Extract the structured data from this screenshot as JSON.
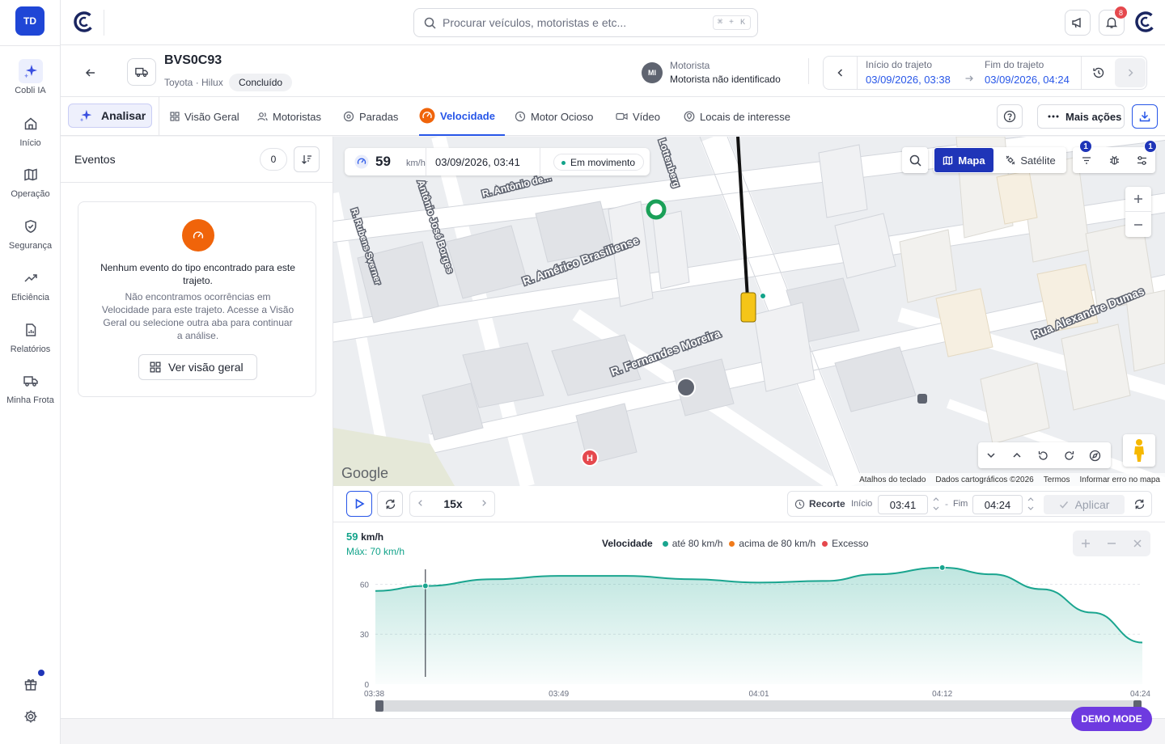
{
  "user": {
    "initials": "TD"
  },
  "nav": {
    "items": [
      {
        "label": "Cobli IA",
        "icon": "sparkle-icon"
      },
      {
        "label": "Início",
        "icon": "home-icon"
      },
      {
        "label": "Operação",
        "icon": "map-icon"
      },
      {
        "label": "Segurança",
        "icon": "shield-icon"
      },
      {
        "label": "Eficiência",
        "icon": "trend-icon"
      },
      {
        "label": "Relatórios",
        "icon": "report-icon"
      },
      {
        "label": "Minha Frota",
        "icon": "truck-icon"
      }
    ]
  },
  "topbar": {
    "search_placeholder": "Procurar veículos, motoristas e etc...",
    "shortcut": "⌘ + K",
    "notifications_count": "8"
  },
  "vehicle": {
    "plate": "BVS0C93",
    "model": "Toyota · Hilux",
    "status": "Concluído"
  },
  "driver": {
    "initials": "MI",
    "label": "Motorista",
    "name": "Motorista não identificado"
  },
  "trip": {
    "start_label": "Início do trajeto",
    "start_value": "03/09/2026, 03:38",
    "end_label": "Fim do trajeto",
    "end_value": "03/09/2026, 04:24"
  },
  "tabs": {
    "analyze": "Analisar",
    "items": [
      {
        "label": "Visão Geral"
      },
      {
        "label": "Motoristas"
      },
      {
        "label": "Paradas"
      },
      {
        "label": "Velocidade",
        "active": true
      },
      {
        "label": "Motor Ocioso"
      },
      {
        "label": "Vídeo"
      },
      {
        "label": "Locais de interesse"
      }
    ],
    "more_actions": "Mais ações"
  },
  "events": {
    "title": "Eventos",
    "count": "0",
    "empty_title": "Nenhum evento do tipo encontrado para este trajeto.",
    "empty_desc": "Não encontramos ocorrências em Velocidade para este trajeto. Acesse a Visão Geral ou selecione outra aba para continuar a análise.",
    "overview_button": "Ver visão geral"
  },
  "map": {
    "speed": "59",
    "speed_unit": "km/h",
    "timestamp": "03/09/2026, 03:41",
    "status": "Em movimento",
    "type_map": "Mapa",
    "type_satellite": "Satélite",
    "filter_badge": "1",
    "settings_badge": "1",
    "streets": [
      "R. Antônio de...",
      "Antônio José Borges",
      "R. Rubens Sverner",
      "R. Américo Brasiliense",
      "R. Fernandes Moreira",
      "Rua Alexandre Dumas",
      "Lottenberg"
    ],
    "provider": "Google",
    "attribution": [
      "Atalhos do teclado",
      "Dados cartográficos ©2026",
      "Termos",
      "Informar erro no mapa"
    ]
  },
  "playback": {
    "speed": "15x",
    "cut_label": "Recorte",
    "start_label": "Início",
    "start_value": "03:41",
    "end_label": "Fim",
    "end_value": "04:24",
    "apply": "Aplicar"
  },
  "speed_summary": {
    "current": "59",
    "unit": "km/h",
    "max": "Máx: 70 km/h"
  },
  "chart_data": {
    "type": "area",
    "title": "Velocidade",
    "legend": [
      {
        "name": "até 80 km/h",
        "color": "#1aa58f"
      },
      {
        "name": "acima de 80 km/h",
        "color": "#f07a1a"
      },
      {
        "name": "Excesso",
        "color": "#e5484d"
      }
    ],
    "x": [
      "03:38",
      "03:41",
      "03:45",
      "03:49",
      "03:53",
      "03:57",
      "04:01",
      "04:05",
      "04:08",
      "04:12",
      "04:15",
      "04:18",
      "04:21",
      "04:24"
    ],
    "series": [
      {
        "values": [
          56,
          59,
          63,
          65,
          65,
          63,
          61,
          62,
          66,
          70,
          66,
          57,
          43,
          25
        ]
      }
    ],
    "x_ticks": [
      "03:38",
      "03:49",
      "04:01",
      "04:12",
      "04:24"
    ],
    "y_ticks": [
      0,
      30,
      60
    ],
    "ylim": [
      0,
      85
    ],
    "cursor": "03:41",
    "max_point": "04:12"
  },
  "demo_mode": "DEMO MODE",
  "colors": {
    "primary": "#2756e8",
    "nav_active": "#1f35b8",
    "teal": "#1aa58f",
    "orange": "#f0640a"
  }
}
